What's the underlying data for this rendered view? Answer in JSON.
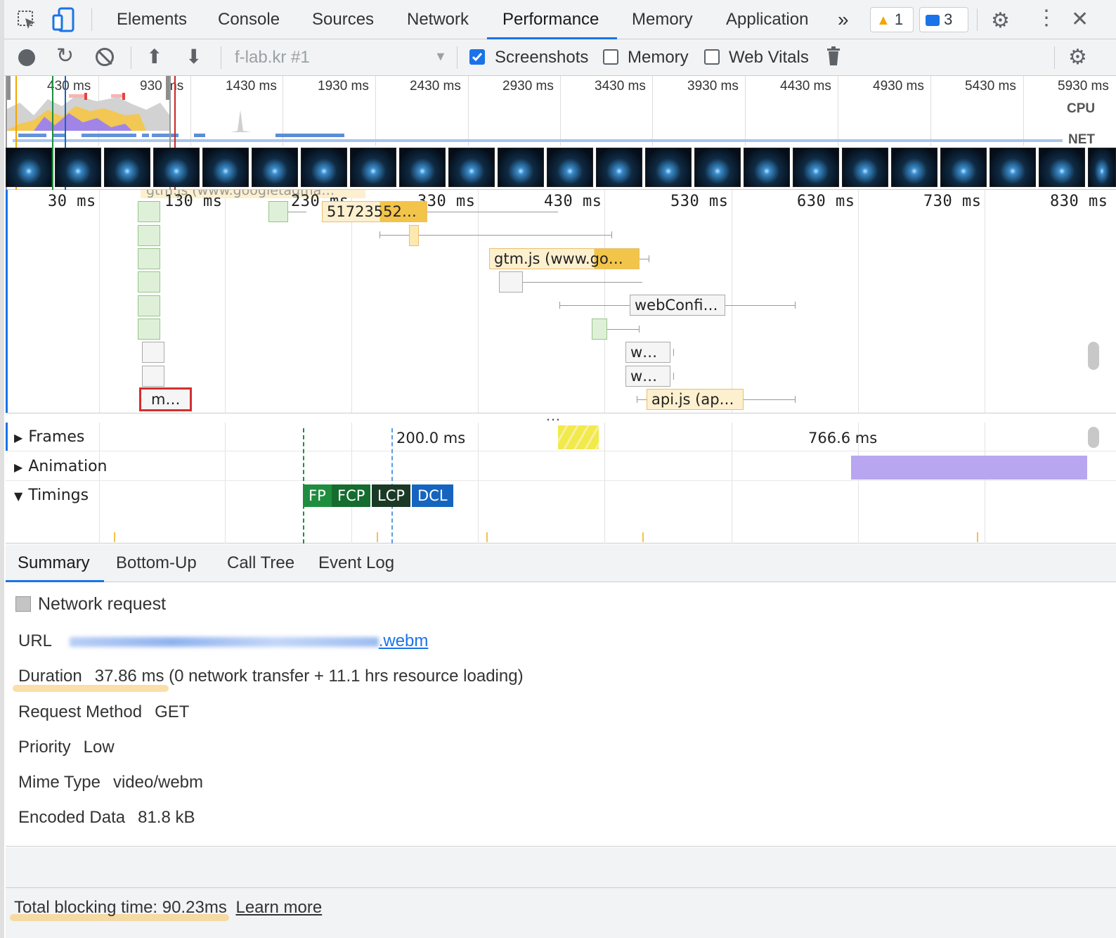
{
  "tabs": [
    "Elements",
    "Console",
    "Sources",
    "Network",
    "Performance",
    "Memory",
    "Application"
  ],
  "active_tab": "Performance",
  "more_tabs": "»",
  "warning_count": "1",
  "message_count": "3",
  "toolbar": {
    "profile_select": "f-lab.kr #1",
    "screenshots_label": "Screenshots",
    "screenshots_checked": true,
    "memory_label": "Memory",
    "memory_checked": false,
    "web_vitals_label": "Web Vitals",
    "web_vitals_checked": false
  },
  "overview": {
    "ticks": [
      "430 ms",
      "930 ms",
      "1430 ms",
      "1930 ms",
      "2430 ms",
      "2930 ms",
      "3430 ms",
      "3930 ms",
      "4430 ms",
      "4930 ms",
      "5430 ms",
      "5930 ms"
    ],
    "cpu_label": "CPU",
    "net_label": "NET"
  },
  "flame": {
    "ticks": [
      "30 ms",
      "130 ms",
      "230 ms",
      "330 ms",
      "430 ms",
      "530 ms",
      "630 ms",
      "730 ms",
      "830 ms"
    ],
    "top_partial_label": "gtm.js (www.googletagma…",
    "bars": {
      "b1": "51723552…",
      "gtm": "gtm.js (www.go…",
      "webconfig": "webConfi…",
      "w1": "w…",
      "w2": "w…",
      "api": "api.js (ap…",
      "selected": "m…"
    },
    "divider": "…"
  },
  "tracks": {
    "frames": "Frames",
    "animation": "Animation",
    "timings": "Timings",
    "frame_200": "200.0 ms",
    "frame_766": "766.6 ms",
    "markers": [
      "FP",
      "FCP",
      "LCP",
      "DCL"
    ]
  },
  "subtabs": [
    "Summary",
    "Bottom-Up",
    "Call Tree",
    "Event Log"
  ],
  "summary": {
    "title": "Network request",
    "url_label": "URL",
    "url_value": ".webm",
    "duration_label": "Duration",
    "duration_value": "37.86 ms",
    "duration_detail": "(0 network transfer + 11.1 hrs resource loading)",
    "method_label": "Request Method",
    "method_value": "GET",
    "priority_label": "Priority",
    "priority_value": "Low",
    "mime_label": "Mime Type",
    "mime_value": "video/webm",
    "encoded_label": "Encoded Data",
    "encoded_value": "81.8 kB"
  },
  "footer": {
    "tbt": "Total blocking time: 90.23ms",
    "learn_more": "Learn more"
  },
  "colors": {
    "accent": "#1a73e8",
    "fp": "#1e8e3e",
    "fcp": "#146c2e",
    "lcp": "#1b3a26",
    "dcl": "#1565c0",
    "animation": "#b9a6f0"
  }
}
